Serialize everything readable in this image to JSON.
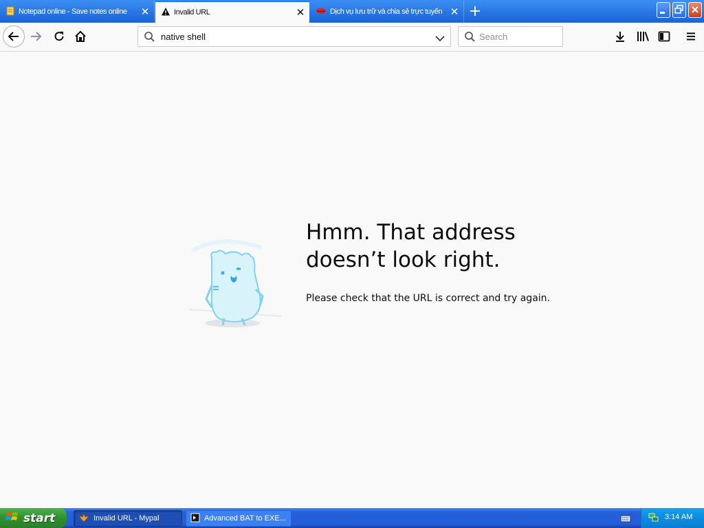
{
  "tabs": [
    {
      "title": "Notepad online - Save notes online",
      "icon": "notepad-icon"
    },
    {
      "title": "Invalid URL",
      "icon": "warning-icon"
    },
    {
      "title": "Dịch vụ lưu trữ và chia sẻ trực tuyến",
      "icon": "lips-icon"
    }
  ],
  "address_bar": {
    "value": "native shell"
  },
  "search_bar": {
    "placeholder": "Search"
  },
  "error_page": {
    "title": "Hmm. That address doesn’t look right.",
    "description": "Please check that the URL is correct and try again."
  },
  "taskbar": {
    "start_label": "start",
    "tasks": [
      {
        "label": "Invalid URL - Mypal",
        "active": true
      },
      {
        "label": "Advanced BAT to EXE...",
        "active": false
      }
    ],
    "clock": "3:14 AM"
  },
  "colors": {
    "accent": "#0a84ff",
    "titlebar": "#2a6fe0",
    "taskbar": "#245edb",
    "start": "#3a9a3a"
  }
}
